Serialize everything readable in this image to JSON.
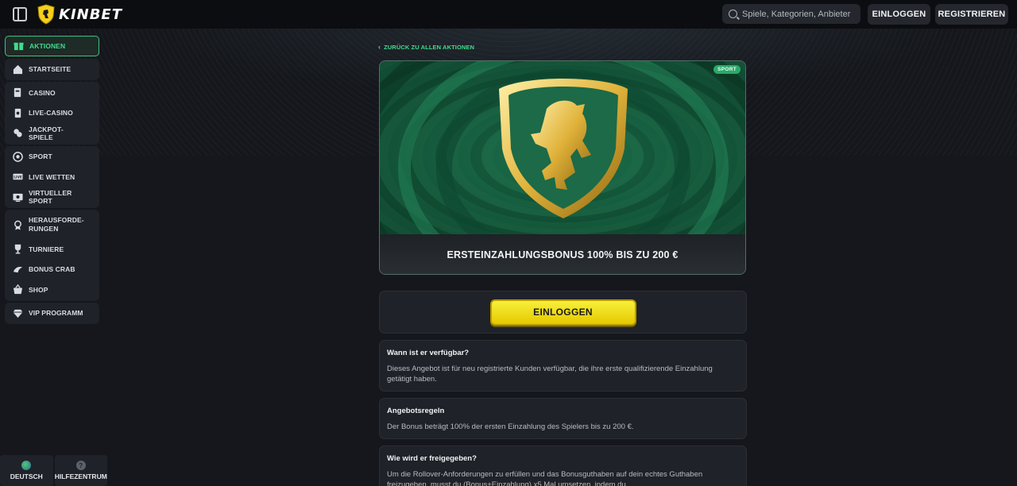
{
  "header": {
    "brand": "KINBET",
    "search_placeholder": "Spiele, Kategorien, Anbieter",
    "login_label": "EINLOGGEN",
    "register_label": "REGISTRIEREN"
  },
  "sidebar": {
    "groups": [
      [
        {
          "label": "AKTIONEN",
          "icon": "gift-icon"
        }
      ],
      [
        {
          "label": "STARTSEITE",
          "icon": "home-icon"
        }
      ],
      [
        {
          "label": "CASINO",
          "icon": "casino-icon"
        },
        {
          "label": "LIVE-CASINO",
          "icon": "live-casino-icon"
        },
        {
          "label": "JACKPOT-SPIELE",
          "icon": "jackpot-icon"
        }
      ],
      [
        {
          "label": "SPORT",
          "icon": "soccer-ball-icon"
        },
        {
          "label": "LIVE WETTEN",
          "icon": "live-bets-icon"
        },
        {
          "label": "VIRTUELLER SPORT",
          "icon": "virtual-sport-icon"
        }
      ],
      [
        {
          "label": "HERAUSFORDE-RUNGEN",
          "icon": "challenge-icon"
        },
        {
          "label": "TURNIERE",
          "icon": "trophy-icon"
        },
        {
          "label": "BONUS CRAB",
          "icon": "crab-icon"
        },
        {
          "label": "SHOP",
          "icon": "basket-icon"
        }
      ],
      [
        {
          "label": "VIP PROGRAMM",
          "icon": "diamond-icon"
        }
      ]
    ],
    "bottom": {
      "language": "DEUTSCH",
      "help": "HILFEZENTRUM"
    }
  },
  "main": {
    "back_link": "ZURÜCK ZU ALLEN AKTIONEN",
    "promo": {
      "tag": "SPORT",
      "title": "ERSTEINZAHLUNGSBONUS 100% BIS ZU 200 €"
    },
    "cta_label": "EINLOGGEN",
    "sections": [
      {
        "title": "Wann ist er verfügbar?",
        "text": "Dieses Angebot ist für neu registrierte Kunden verfügbar, die ihre erste qualifizierende Einzahlung getätigt haben."
      },
      {
        "title": "Angebotsregeln",
        "text": "Der Bonus beträgt 100% der ersten Einzahlung des Spielers bis zu 200 €."
      },
      {
        "title": "Wie wird er freigegeben?",
        "text": "Um die Rollover-Anforderungen zu erfüllen und das Bonusguthaben auf dein echtes Guthaben freizugeben, musst du (Bonus+Einzahlung) x5 Mal umsetzen, indem du"
      }
    ]
  },
  "colors": {
    "accent": "#3fdc8a",
    "cta": "#f2e51e",
    "background": "#15171c"
  }
}
